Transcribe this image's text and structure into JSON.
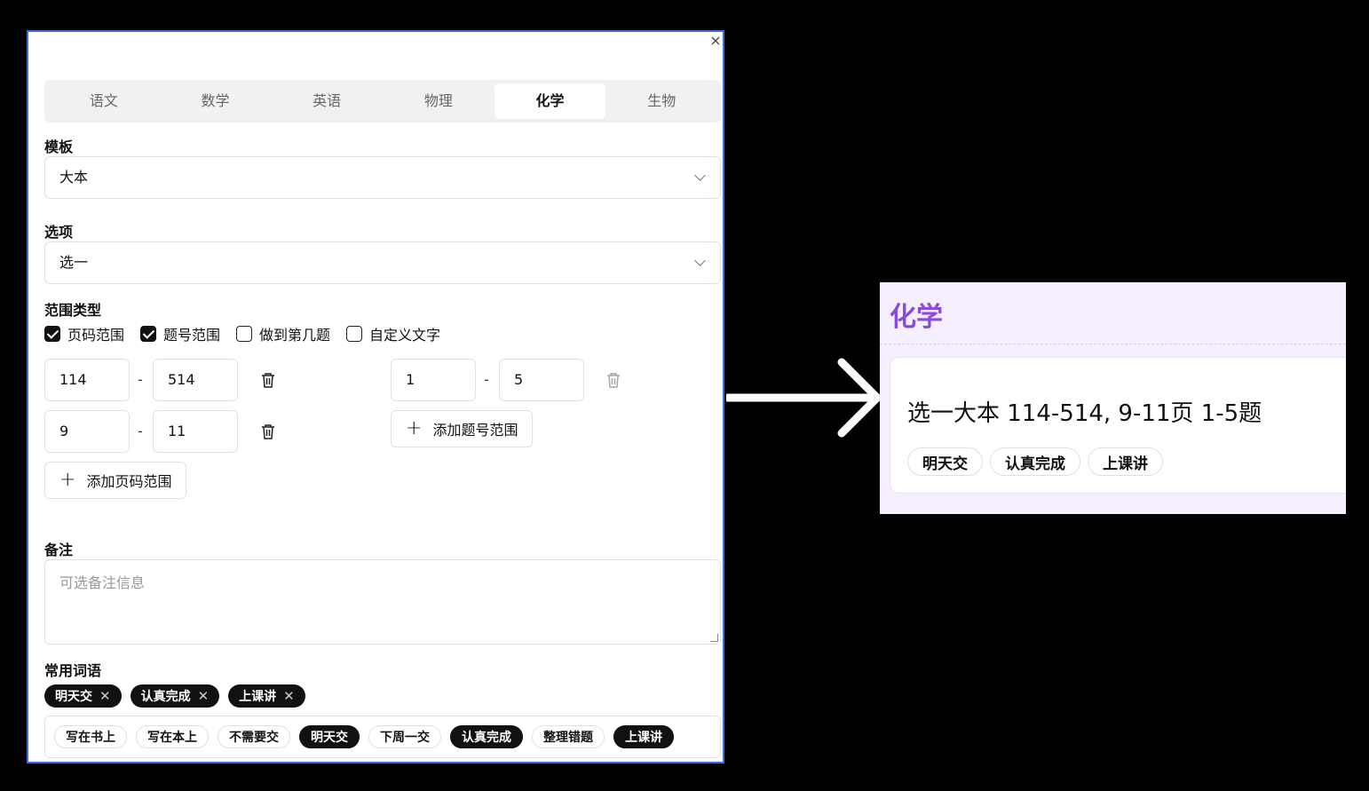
{
  "dialog": {
    "close_label": "×",
    "tabs": [
      "语文",
      "数学",
      "英语",
      "物理",
      "化学",
      "生物"
    ],
    "active_tab": "化学",
    "template": {
      "label": "模板",
      "value": "大本"
    },
    "option": {
      "label": "选项",
      "value": "选一"
    },
    "range_type": {
      "label": "范围类型",
      "options": [
        {
          "label": "页码范围",
          "checked": true
        },
        {
          "label": "题号范围",
          "checked": true
        },
        {
          "label": "做到第几题",
          "checked": false
        },
        {
          "label": "自定义文字",
          "checked": false
        }
      ]
    },
    "page_ranges": [
      {
        "from": "114",
        "to": "514"
      },
      {
        "from": "9",
        "to": "11"
      }
    ],
    "question_ranges": [
      {
        "from": "1",
        "to": "5"
      }
    ],
    "range_separator": "-",
    "add_page_range_label": "添加页码范围",
    "add_question_range_label": "添加题号范围",
    "notes": {
      "label": "备注",
      "placeholder": "可选备注信息"
    },
    "phrases": {
      "label": "常用词语",
      "selected": [
        "明天交",
        "认真完成",
        "上课讲"
      ],
      "all": [
        {
          "text": "写在书上",
          "selected": false
        },
        {
          "text": "写在本上",
          "selected": false
        },
        {
          "text": "不需要交",
          "selected": false
        },
        {
          "text": "明天交",
          "selected": true
        },
        {
          "text": "下周一交",
          "selected": false
        },
        {
          "text": "认真完成",
          "selected": true
        },
        {
          "text": "整理错题",
          "selected": false
        },
        {
          "text": "上课讲",
          "selected": true
        }
      ]
    }
  },
  "preview": {
    "subject": "化学",
    "summary": "选一大本 114-514, 9-11页 1-5题",
    "tags": [
      "明天交",
      "认真完成",
      "上课讲"
    ],
    "accent_color": "#8a4bdb"
  }
}
